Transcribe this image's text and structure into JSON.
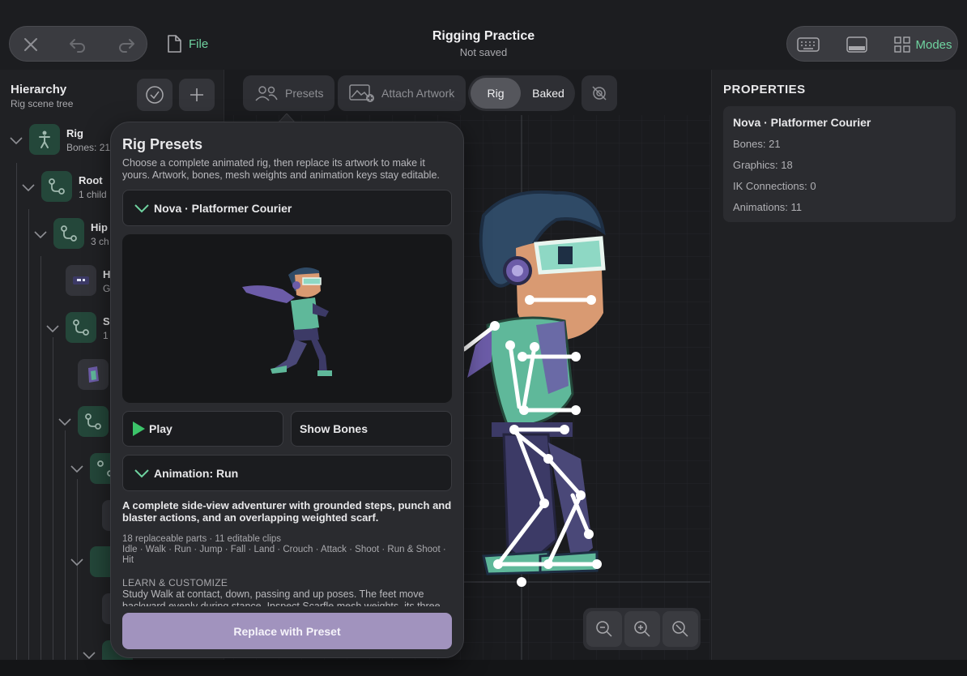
{
  "app": {
    "title": "Rigging Practice",
    "save_status": "Not saved",
    "file_label": "File",
    "modes_label": "Modes",
    "accent": "#6fd3a0"
  },
  "hierarchy": {
    "title": "Hierarchy",
    "subtitle": "Rig scene tree",
    "nodes": [
      {
        "name": "Rig",
        "meta": "Bones: 21",
        "icon": "person-icon"
      },
      {
        "name": "Root",
        "meta": "1 child",
        "icon": "bone-icon"
      },
      {
        "name": "Hip",
        "meta": "3 ch",
        "icon": "bone-icon"
      },
      {
        "name": "H",
        "meta": "G",
        "icon": "graphic-icon"
      },
      {
        "name": "S",
        "meta": "1",
        "icon": "bone-icon"
      }
    ]
  },
  "toolbar": {
    "presets_label": "Presets",
    "attach_label": "Attach Artwork",
    "rig_label": "Rig",
    "baked_label": "Baked"
  },
  "popover": {
    "title": "Rig Presets",
    "description": "Choose a complete animated rig, then replace its artwork to make it yours. Artwork, bones, mesh weights and animation keys stay editable.",
    "selected_preset": "Nova · Platformer Courier",
    "play_label": "Play",
    "show_bones_label": "Show Bones",
    "animation_select": "Animation: Run",
    "body": "A complete side-view adventurer with grounded steps, punch and blaster actions, and an overlapping weighted scarf.",
    "stats_line1": "18 replaceable parts · 11 editable clips",
    "stats_line2": "Idle · Walk · Run · Jump · Fall · Land · Crouch · Attack · Shoot · Run & Shoot · Hit",
    "learn_heading": "LEARN & CUSTOMIZE",
    "learn_text": "Study Walk at contact, down, passing and up poses. The feet move backward evenly during stance. Inspect Scarfle mesh weights, its three",
    "replace_label": "Replace with Preset"
  },
  "properties": {
    "title": "PROPERTIES",
    "name": "Nova · Platformer Courier",
    "bones": "Bones: 21",
    "graphics": "Graphics: 18",
    "ik": "IK Connections: 0",
    "animations": "Animations: 11"
  }
}
